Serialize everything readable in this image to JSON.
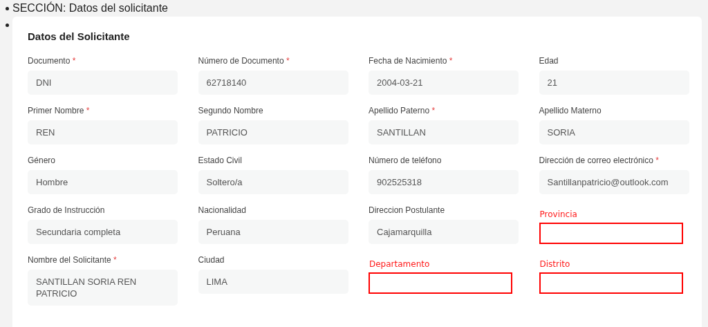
{
  "section_heading": "SECCIÓN: Datos del solicitante",
  "card": {
    "title": "Datos del Solicitante",
    "fields": [
      {
        "kind": "filled",
        "label": "Documento",
        "required_mark": "*",
        "value": "DNI"
      },
      {
        "kind": "filled",
        "label": "Número de Documento",
        "required_mark": "*",
        "value": "62718140"
      },
      {
        "kind": "filled",
        "label": "Fecha de Nacimiento",
        "required_mark": "*",
        "value": "2004-03-21"
      },
      {
        "kind": "filled",
        "label": "Edad",
        "value": "21"
      },
      {
        "kind": "filled",
        "label": "Primer Nombre",
        "required_mark": "*",
        "value": "REN"
      },
      {
        "kind": "filled",
        "label": "Segundo Nombre",
        "value": "PATRICIO"
      },
      {
        "kind": "filled",
        "label": "Apellido Paterno",
        "required_mark": "*",
        "value": "SANTILLAN"
      },
      {
        "kind": "filled",
        "label": "Apellido Materno",
        "value": "SORIA"
      },
      {
        "kind": "filled",
        "label": "Género",
        "value": "Hombre"
      },
      {
        "kind": "filled",
        "label": "Estado Civil",
        "value": "Soltero/a"
      },
      {
        "kind": "filled",
        "label": "Número de teléfono",
        "value": "902525318"
      },
      {
        "kind": "filled",
        "label": "Dirección de correo electrónico",
        "required_mark": "*",
        "value": "Santillanpatricio@outlook.com"
      },
      {
        "kind": "filled",
        "label": "Grado de Instrucción",
        "value": "Secundaria completa"
      },
      {
        "kind": "filled",
        "label": "Nacionalidad",
        "value": "Peruana"
      },
      {
        "kind": "filled",
        "label": "Direccion Postulante",
        "value": "Cajamarquilla"
      },
      {
        "kind": "missing",
        "label": "Provincia"
      },
      {
        "kind": "filled",
        "label": "Nombre del Solicitante",
        "required_mark": "*",
        "value": "SANTILLAN SORIA REN PATRICIO"
      },
      {
        "kind": "filled",
        "label": "Ciudad",
        "value": "LIMA"
      },
      {
        "kind": "missing",
        "label": "Departamento"
      },
      {
        "kind": "missing",
        "label": "Distrito"
      }
    ]
  }
}
